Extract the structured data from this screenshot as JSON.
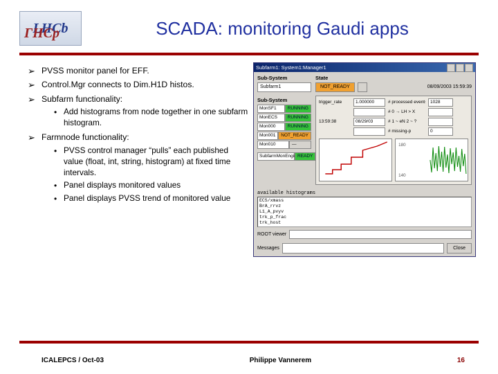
{
  "logo": {
    "line1": "LHCb",
    "line2": "ГНСр"
  },
  "title": "SCADA: monitoring Gaudi apps",
  "bullets": {
    "b1": "PVSS monitor panel for EFF.",
    "b2": "Control.Mgr connects to Dim.H1D histos.",
    "b3": "Subfarm functionality:",
    "b3_1": "Add histograms from node together in one subfarm histogram.",
    "b4": "Farmnode functionality:",
    "b4_1": "PVSS control manager “pulls” each published value (float, int, string, histogram) at fixed time intervals.",
    "b4_2": "Panel displays monitored values",
    "b4_3": "Panel displays PVSS trend of monitored value"
  },
  "window": {
    "title": "Subfarm1: System1:Manager1",
    "subsystem_label": "Sub-System",
    "subsystem_value": "Subfarm1",
    "state_label": "State",
    "state_value": "NOT_READY",
    "timestamp": "08/09/2003 15:59:39",
    "subitems_label": "Sub-System",
    "substate_label": "State",
    "rows": [
      {
        "name": "MonSF1",
        "state": "RUNNING",
        "cls": "green"
      },
      {
        "name": "MonECS",
        "state": "RUNNING",
        "cls": "green"
      },
      {
        "name": "Mon000",
        "state": "RUNNING",
        "cls": "green"
      },
      {
        "name": "Mon001",
        "state": "NOT_READY",
        "cls": "orange"
      },
      {
        "name": "Mon010",
        "state": "—",
        "cls": ""
      }
    ],
    "sf_monitor": {
      "name": "SubfarmMonEngine",
      "state": "READY",
      "cls": "green"
    },
    "kv": {
      "k1": "trigger_rate",
      "v1": "1.000000",
      "k2": "# processed events",
      "v2": "1028",
      "k3": "",
      "v3": "",
      "k4": "# 0 → LH > X",
      "v4": "",
      "k5": "13:59:38",
      "v5": "08/29/03",
      "k6": "# 1 ~ eN  2 ~ ?",
      "v6": "",
      "k7": "",
      "v7": "",
      "k8": "# missing-p",
      "v8": "0"
    },
    "avail_label": "available histograms",
    "hist_lines": "ECS/xmass\nBrA_rrvz\nL1_A_pvyv\ntrk_p_frac\ntrk_host",
    "root_label": "ROOT viewer",
    "messages_label": "Messages",
    "close": "Close"
  },
  "chart_data": [
    {
      "type": "line",
      "note": "small trend plot, red stepped line rising left-to-right; axes unlabeled; decorative",
      "x": [
        0,
        1,
        2,
        3,
        4,
        5,
        6,
        7,
        8,
        9,
        10
      ],
      "values": [
        3,
        3,
        5,
        5,
        8,
        8,
        12,
        12,
        18,
        22,
        30
      ],
      "color": "#c00000"
    },
    {
      "type": "line",
      "note": "green noisy time-series filling right half of mini-chart; y roughly 140–180 range per faint axis ticks",
      "x": [
        0,
        1,
        2,
        3,
        4,
        5,
        6,
        7,
        8,
        9,
        10,
        11,
        12,
        13,
        14,
        15,
        16,
        17,
        18,
        19,
        20,
        21,
        22,
        23,
        24,
        25,
        26,
        27,
        28,
        29
      ],
      "values": [
        162,
        140,
        175,
        150,
        168,
        145,
        180,
        155,
        170,
        148,
        178,
        152,
        166,
        142,
        176,
        158,
        171,
        149,
        179,
        153,
        165,
        147,
        177,
        151,
        169,
        144,
        181,
        156,
        172,
        150
      ],
      "ylim": [
        130,
        190
      ],
      "color": "#0a8a0a"
    }
  ],
  "footer": {
    "left": "ICALEPCS / Oct-03",
    "center": "Philippe Vannerem",
    "page": "16"
  }
}
